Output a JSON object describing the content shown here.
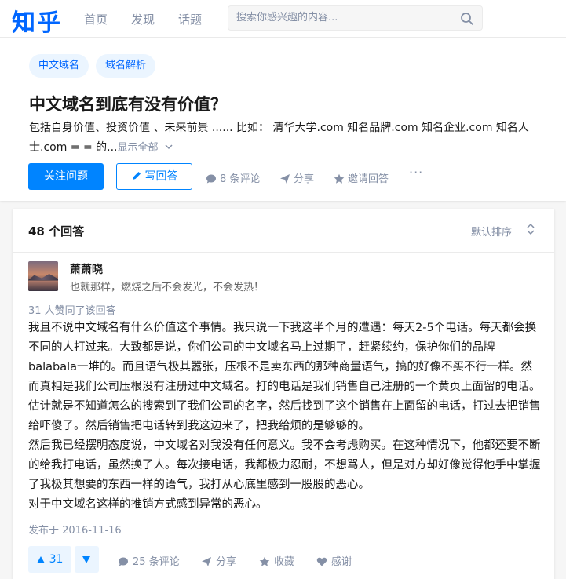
{
  "topnav": {
    "logo": "知乎",
    "links": [
      "首页",
      "发现",
      "话题"
    ],
    "search_placeholder": "搜索你感兴趣的内容..."
  },
  "question": {
    "tags": [
      "中文域名",
      "域名解析"
    ],
    "title": "中文域名到底有没有价值？",
    "description": "包括自身价值、投资价值 、未来前景 ...... 比如： 清华大学.com 知名品牌.com 知名企业.com 知名人士.com = = 的...",
    "show_all": "显示全部",
    "follow_label": "关注问题",
    "answer_label": "写回答",
    "comments_label": "8 条评论",
    "share_label": "分享",
    "invite_label": "邀请回答",
    "more_label": "···"
  },
  "answers": {
    "count_label": "48 个回答",
    "sort_label": "默认排序",
    "item": {
      "author": "萧萧晓",
      "bio": "也就那样，燃烧之后不会发光，不会发热！",
      "voters": "31 人赞同了该回答",
      "paragraphs": [
        "我且不说中文域名有什么价值这个事情。我只说一下我这半个月的遭遇：每天2-5个电话。每天都会换不同的人打过来。大致都是说，你们公司的中文域名马上过期了，赶紧续约，保护你们的品牌balabala一堆的。而且语气极其嚣张，压根不是卖东西的那种商量语气，搞的好像不买不行一样。然而真相是我们公司压根没有注册过中文域名。打的电话是我们销售自己注册的一个黄页上面留的电话。估计就是不知道怎么的搜索到了我们公司的名字，然后找到了这个销售在上面留的电话，打过去把销售给吓傻了。然后销售把电话转到我这边来了，把我给烦的是够够的。",
        "然后我已经摆明态度说，中文域名对我没有任何意义。我不会考虑购买。在这种情况下，他都还要不断的给我打电话，虽然换了人。每次接电话，我都极力忍耐，不想骂人，但是对方却好像觉得他手中掌握了我极其想要的东西一样的语气，我打从心底里感到一股股的恶心。",
        "对于中文域名这样的推销方式感到异常的恶心。"
      ],
      "published": "发布于 2016-11-16",
      "upvotes": "31",
      "comments_label": "25 条评论",
      "share_label": "分享",
      "collect_label": "收藏",
      "thanks_label": "感谢"
    }
  },
  "colors": {
    "brand": "#0066ff",
    "primary_button": "#0084ff",
    "muted": "#8590a6",
    "tag_bg": "#ebf5ff",
    "page_bg": "#f6f6f6"
  },
  "icons": [
    "search-icon",
    "pencil-icon",
    "comment-icon",
    "share-icon",
    "invite-icon",
    "more-icon",
    "sort-icon",
    "upvote-icon",
    "downvote-icon",
    "collect-icon",
    "heart-icon",
    "chevron-down-icon"
  ]
}
